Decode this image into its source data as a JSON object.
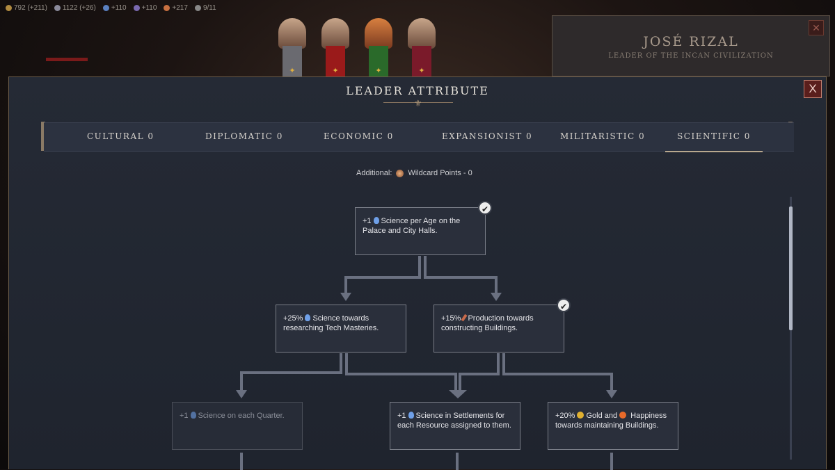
{
  "topbar": {
    "res1": "792 (+211)",
    "res2": "1122 (+26)",
    "res3": "+110",
    "res4": "+110",
    "res5": "+217",
    "res6": "9/11"
  },
  "leader_panel": {
    "name": "JOSÉ RIZAL",
    "title": "LEADER OF THE INCAN CIVILIZATION"
  },
  "modal": {
    "title": "LEADER ATTRIBUTE",
    "close_label": "X"
  },
  "tabs": [
    {
      "label": "CULTURAL 0"
    },
    {
      "label": "DIPLOMATIC 0"
    },
    {
      "label": "ECONOMIC 0"
    },
    {
      "label": "EXPANSIONIST 0"
    },
    {
      "label": "MILITARISTIC 0"
    },
    {
      "label": "SCIENTIFIC 0"
    }
  ],
  "active_tab": "SCIENTIFIC 0",
  "wildcard": {
    "prefix": "Additional:",
    "text": "Wildcard Points - 0"
  },
  "nodes": {
    "n1": {
      "pre": "+1",
      "text": "Science per Age on the Palace and City Halls.",
      "icon": "science-icon",
      "unlocked": true
    },
    "n2": {
      "pre": "+25%",
      "text": "Science towards researching Tech Masteries.",
      "icon": "science-icon",
      "unlocked": false
    },
    "n3": {
      "pre": "+15%",
      "text": "Production towards constructing Buildings.",
      "icon": "production-icon",
      "unlocked": true
    },
    "n4": {
      "pre": "+1",
      "text": "Science on each Quarter.",
      "icon": "science-icon",
      "unlocked": false
    },
    "n5": {
      "pre": "+1",
      "text": "Science in Settlements for each Resource assigned to them.",
      "icon": "science-icon",
      "unlocked": false
    },
    "n6": {
      "pre": "+20%",
      "mid": "Gold and",
      "text": "Happiness towards maintaining Buildings.",
      "icon": "gold-icon",
      "icon2": "happiness-icon",
      "unlocked": false
    }
  },
  "colors": {
    "modal_bg": "#252a35",
    "border_gold": "#6b5c49",
    "close_red": "#5a1e1c",
    "connector": "#6a7080"
  }
}
